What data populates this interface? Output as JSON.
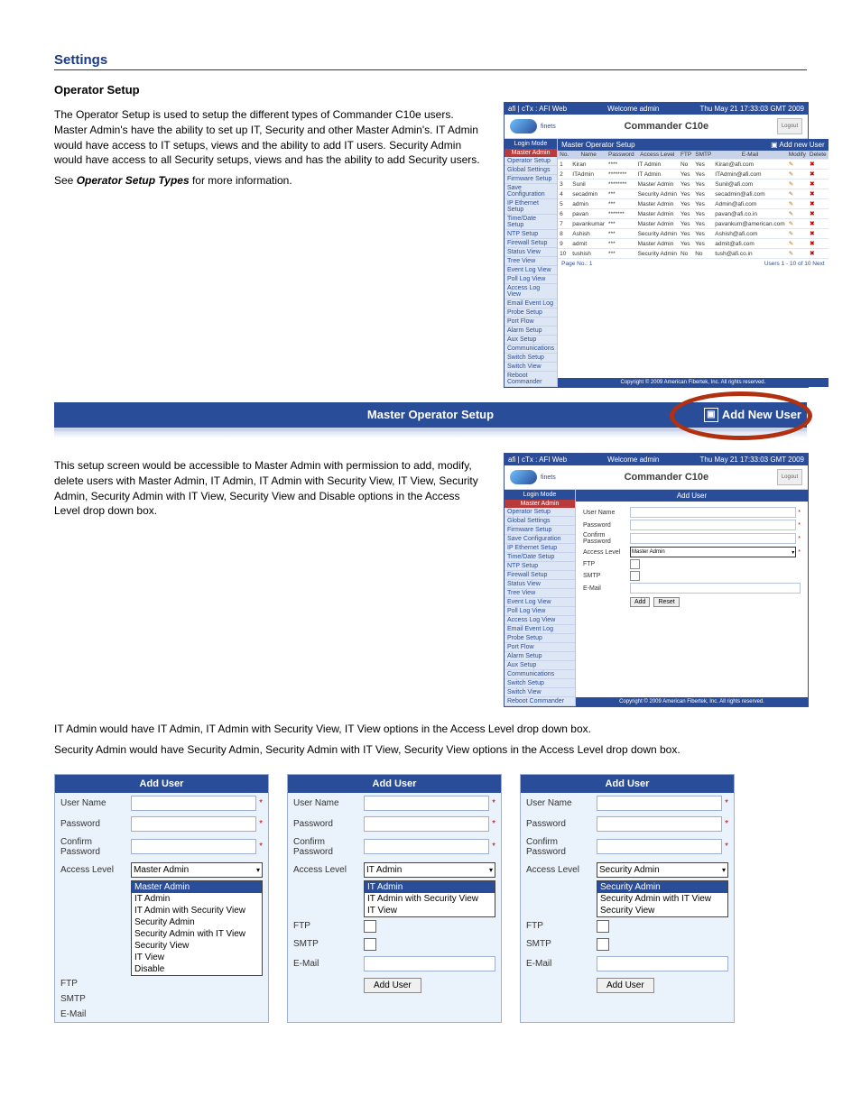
{
  "intro": {
    "h_settings": "Settings",
    "h_operator_setup": "Operator Setup",
    "p1": "The Operator Setup is used to setup the different types of Commander C10e users. Master Admin's have the ability to set up IT, Security and other Master Admin's. IT Admin would have access to IT setups, views and the ability to add IT users. Security Admin would have access to all Security setups, views and has the ability to add Security users.",
    "p2_a": "See",
    "p2_b": "Operator Setup Types",
    "p2_c": "for more information.",
    "p3": "This setup screen would be accessible to Master Admin with permission to add, modify, delete users with Master Admin, IT Admin, IT Admin with Security View, IT View, Security Admin, Security Admin with IT View, Security View and Disable options in the Access Level drop down box.",
    "p4": "IT Admin would have IT Admin, IT Admin with Security View, IT View options in the Access Level drop down box.",
    "p5": "Security Admin would have Security Admin, Security Admin with IT View, Security View options in the Access Level drop down box."
  },
  "bar": {
    "title": "Master Operator Setup",
    "add_btn": "Add New User"
  },
  "brand": {
    "title": "Commander C10e",
    "logout": "Logout",
    "welcome": "Welcome admin",
    "date": "Thu May 21 17:33:03 GMT 2009"
  },
  "sidebar": {
    "login_mode": "Login Mode",
    "role": "Master Admin",
    "items": [
      "Operator Setup",
      "Global Settings",
      "Firmware Setup",
      "Save Configuration",
      "IP Ethernet Setup",
      "Time/Date Setup",
      "NTP Setup",
      "Firewall Setup",
      "Status View",
      "Tree View",
      "Event Log View",
      "Poll Log View",
      "Access Log View",
      "Email Event Log",
      "Probe Setup",
      "Port Flow",
      "Alarm Setup",
      "Aux Setup",
      "Communications",
      "Switch Setup",
      "Switch View",
      "Reboot Commander"
    ]
  },
  "setup_bar": {
    "title": "Master Operator Setup",
    "add": "Add new User"
  },
  "add_user_bar": "Add User",
  "table": {
    "headers": [
      "No.",
      "Name",
      "Password",
      "Access Level",
      "FTP",
      "SMTP",
      "E-Mail",
      "Modify",
      "Delete"
    ],
    "rows": [
      {
        "no": "1",
        "name": "Kiran",
        "pw": "****",
        "al": "IT Admin",
        "ftp": "No",
        "smtp": "Yes",
        "email": "Kiran@afi.com"
      },
      {
        "no": "2",
        "name": "ITAdmin",
        "pw": "********",
        "al": "IT Admin",
        "ftp": "Yes",
        "smtp": "Yes",
        "email": "ITAdmin@afi.com"
      },
      {
        "no": "3",
        "name": "Sunil",
        "pw": "********",
        "al": "Master Admin",
        "ftp": "Yes",
        "smtp": "Yes",
        "email": "Sunil@afi.com"
      },
      {
        "no": "4",
        "name": "secadmin",
        "pw": "***",
        "al": "Security Admin",
        "ftp": "Yes",
        "smtp": "Yes",
        "email": "secadmin@afi.com"
      },
      {
        "no": "5",
        "name": "admin",
        "pw": "***",
        "al": "Master Admin",
        "ftp": "Yes",
        "smtp": "Yes",
        "email": "Admin@afi.com"
      },
      {
        "no": "6",
        "name": "pavan",
        "pw": "*******",
        "al": "Master Admin",
        "ftp": "Yes",
        "smtp": "Yes",
        "email": "pavan@afi.co.in"
      },
      {
        "no": "7",
        "name": "pavankumar",
        "pw": "***",
        "al": "Master Admin",
        "ftp": "Yes",
        "smtp": "Yes",
        "email": "pavankum@american.com"
      },
      {
        "no": "8",
        "name": "Ashish",
        "pw": "***",
        "al": "Security Admin",
        "ftp": "Yes",
        "smtp": "Yes",
        "email": "Ashish@afi.com"
      },
      {
        "no": "9",
        "name": "admit",
        "pw": "***",
        "al": "Master Admin",
        "ftp": "Yes",
        "smtp": "Yes",
        "email": "admit@afi.com"
      },
      {
        "no": "10",
        "name": "tushish",
        "pw": "***",
        "al": "Security Admin",
        "ftp": "No",
        "smtp": "No",
        "email": "tush@afi.co.in"
      }
    ],
    "pager_left": "Page No.: 1",
    "pager_right": "Users 1 - 10 of 10   Next"
  },
  "form": {
    "username": "User Name",
    "password": "Password",
    "confirm": "Confirm Password",
    "access_level": "Access Level",
    "ftp": "FTP",
    "smtp": "SMTP",
    "email": "E-Mail",
    "sel_master": "Master Admin",
    "btn_add": "Add",
    "btn_reset": "Reset"
  },
  "panels": {
    "header": "Add User",
    "username": "User Name",
    "password": "Password",
    "confirm_a": "Confirm",
    "confirm_b": "Password",
    "access_level": "Access Level",
    "ftp": "FTP",
    "smtp": "SMTP",
    "email": "E-Mail",
    "btn_add_user": "Add User",
    "master_sel": "Master Admin",
    "master_opts": [
      "Master Admin",
      "IT Admin",
      "IT Admin with Security View",
      "Security Admin",
      "Security Admin with IT View",
      "Security View",
      "IT View",
      "Disable"
    ],
    "it_sel": "IT Admin",
    "it_opts": [
      "IT Admin",
      "IT Admin with Security View",
      "IT View"
    ],
    "sec_sel": "Security Admin",
    "sec_opts": [
      "Security Admin",
      "Security Admin with IT View",
      "Security View"
    ]
  },
  "copyright": "Copyright © 2009 American Fibertek, Inc. All rights reserved."
}
